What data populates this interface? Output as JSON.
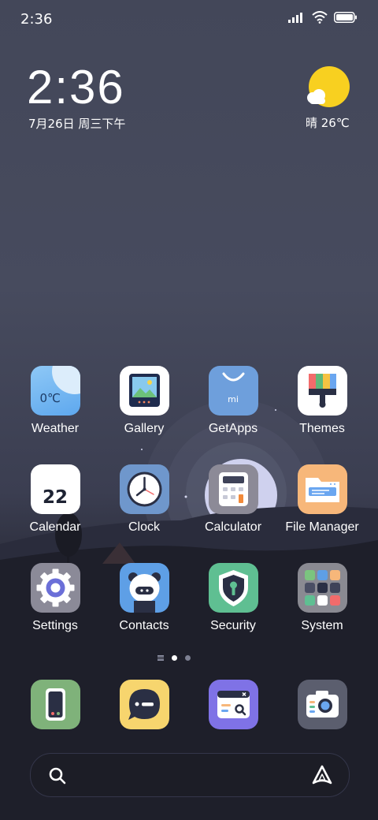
{
  "status_bar": {
    "time": "2:36"
  },
  "clock_widget": {
    "time": "2:36",
    "date": "7月26日 周三下午",
    "weather": "晴 26℃"
  },
  "apps": [
    {
      "label": "Weather",
      "icon": "weather-icon",
      "badge_text": "0℃"
    },
    {
      "label": "Gallery",
      "icon": "gallery-icon"
    },
    {
      "label": "GetApps",
      "icon": "getapps-icon",
      "badge_text": "mi"
    },
    {
      "label": "Themes",
      "icon": "themes-icon"
    },
    {
      "label": "Calendar",
      "icon": "calendar-icon",
      "badge_text": "22"
    },
    {
      "label": "Clock",
      "icon": "clock-icon"
    },
    {
      "label": "Calculator",
      "icon": "calculator-icon"
    },
    {
      "label": "File Manager",
      "icon": "file-manager-icon"
    },
    {
      "label": "Settings",
      "icon": "settings-icon"
    },
    {
      "label": "Contacts",
      "icon": "contacts-icon"
    },
    {
      "label": "Security",
      "icon": "security-icon"
    },
    {
      "label": "System",
      "icon": "system-folder-icon"
    }
  ],
  "dock": [
    {
      "icon": "phone-icon"
    },
    {
      "icon": "messaging-icon"
    },
    {
      "icon": "browser-icon"
    },
    {
      "icon": "camera-icon"
    }
  ],
  "page_indicator": {
    "pages": 2,
    "current": 1
  },
  "colors": {
    "sun": "#f8d020",
    "background": "#434759"
  }
}
